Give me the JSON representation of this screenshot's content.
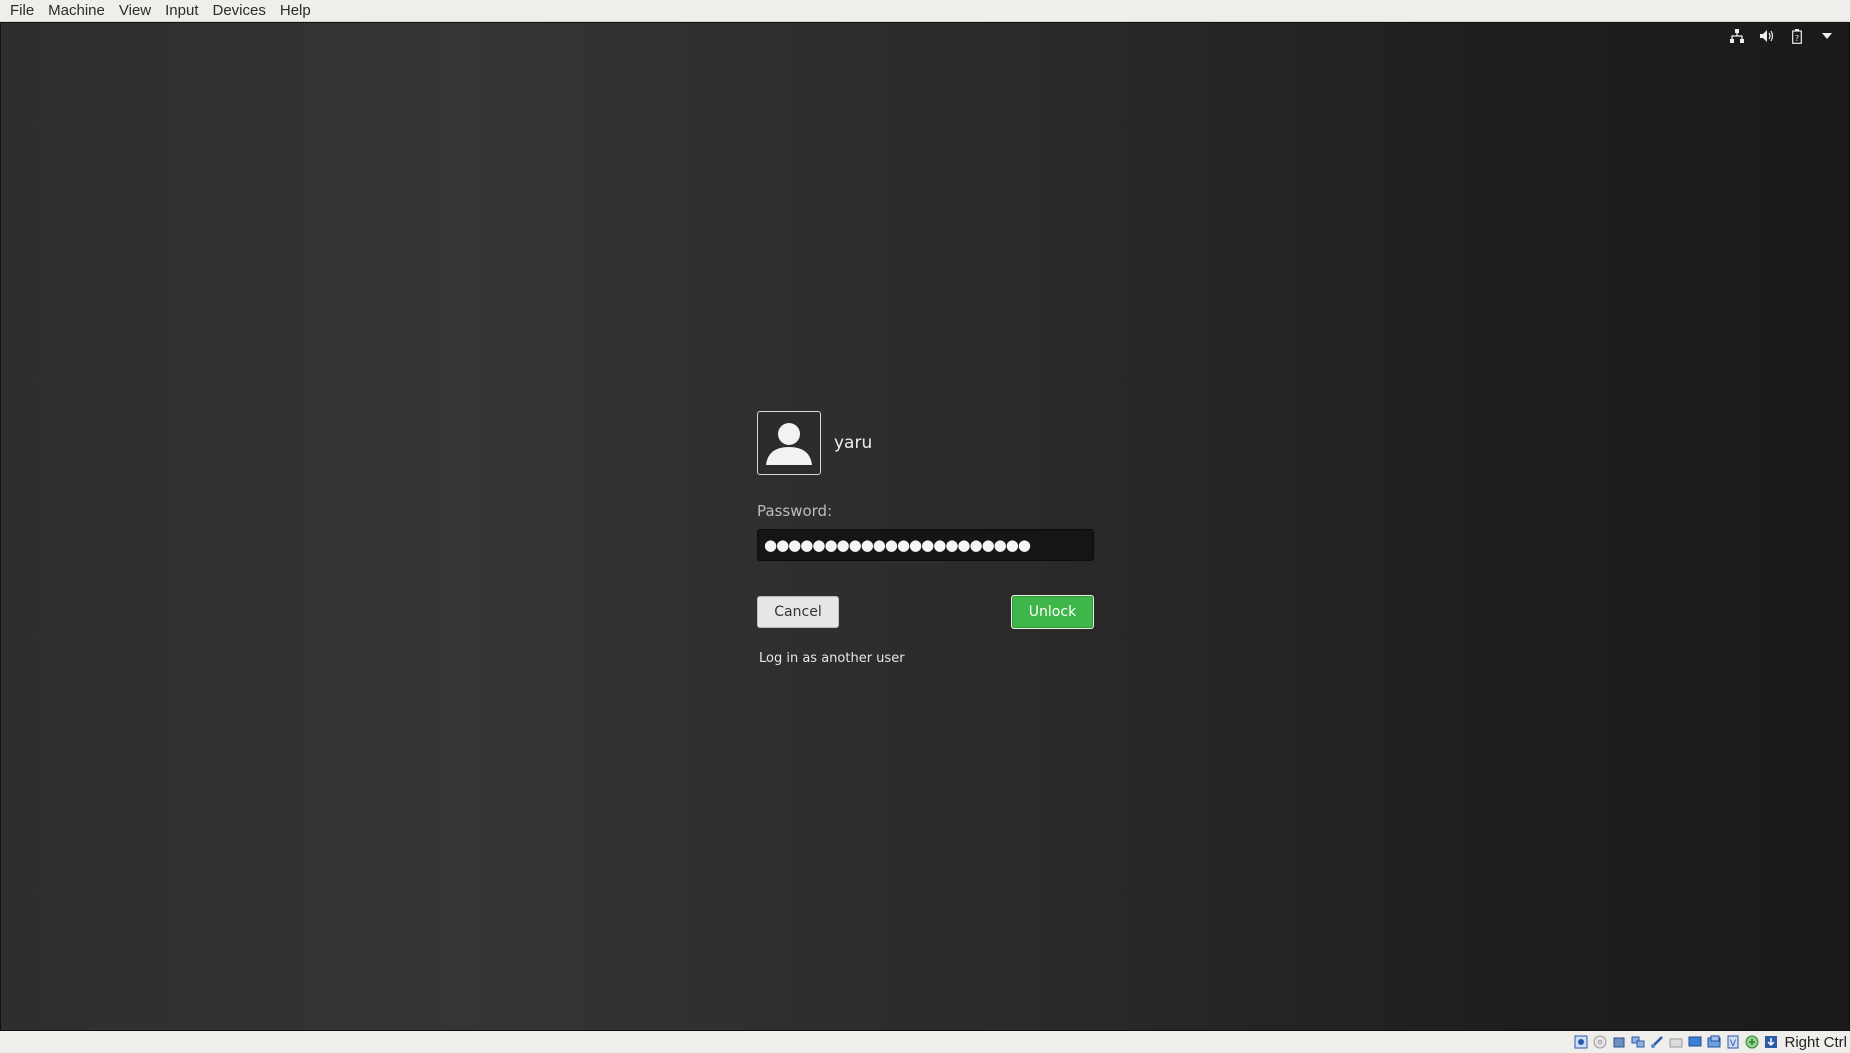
{
  "menubar": {
    "items": [
      {
        "label": "File"
      },
      {
        "label": "Machine"
      },
      {
        "label": "View"
      },
      {
        "label": "Input"
      },
      {
        "label": "Devices"
      },
      {
        "label": "Help"
      }
    ]
  },
  "indicators": [
    "network-icon",
    "volume-icon",
    "battery-icon",
    "menu-arrow-icon"
  ],
  "lock": {
    "username": "yaru",
    "password_label": "Password:",
    "password_mask": "●●●●●●●●●●●●●●●●●●●●●●",
    "cancel_label": "Cancel",
    "unlock_label": "Unlock",
    "other_user_label": "Log in as another user"
  },
  "statusbar": {
    "icons": [
      "hard-disk-icon",
      "optical-disk-icon",
      "audio-icon",
      "network-adapter-icon",
      "usb-icon",
      "shared-folder-icon",
      "display-icon",
      "video-capture-icon",
      "cpu-icon",
      "mouse-integration-icon",
      "keyboard-icon"
    ],
    "host_key": "Right Ctrl"
  },
  "colors": {
    "accent_unlock": "#3fb64a",
    "background": "#2a2a2a"
  }
}
